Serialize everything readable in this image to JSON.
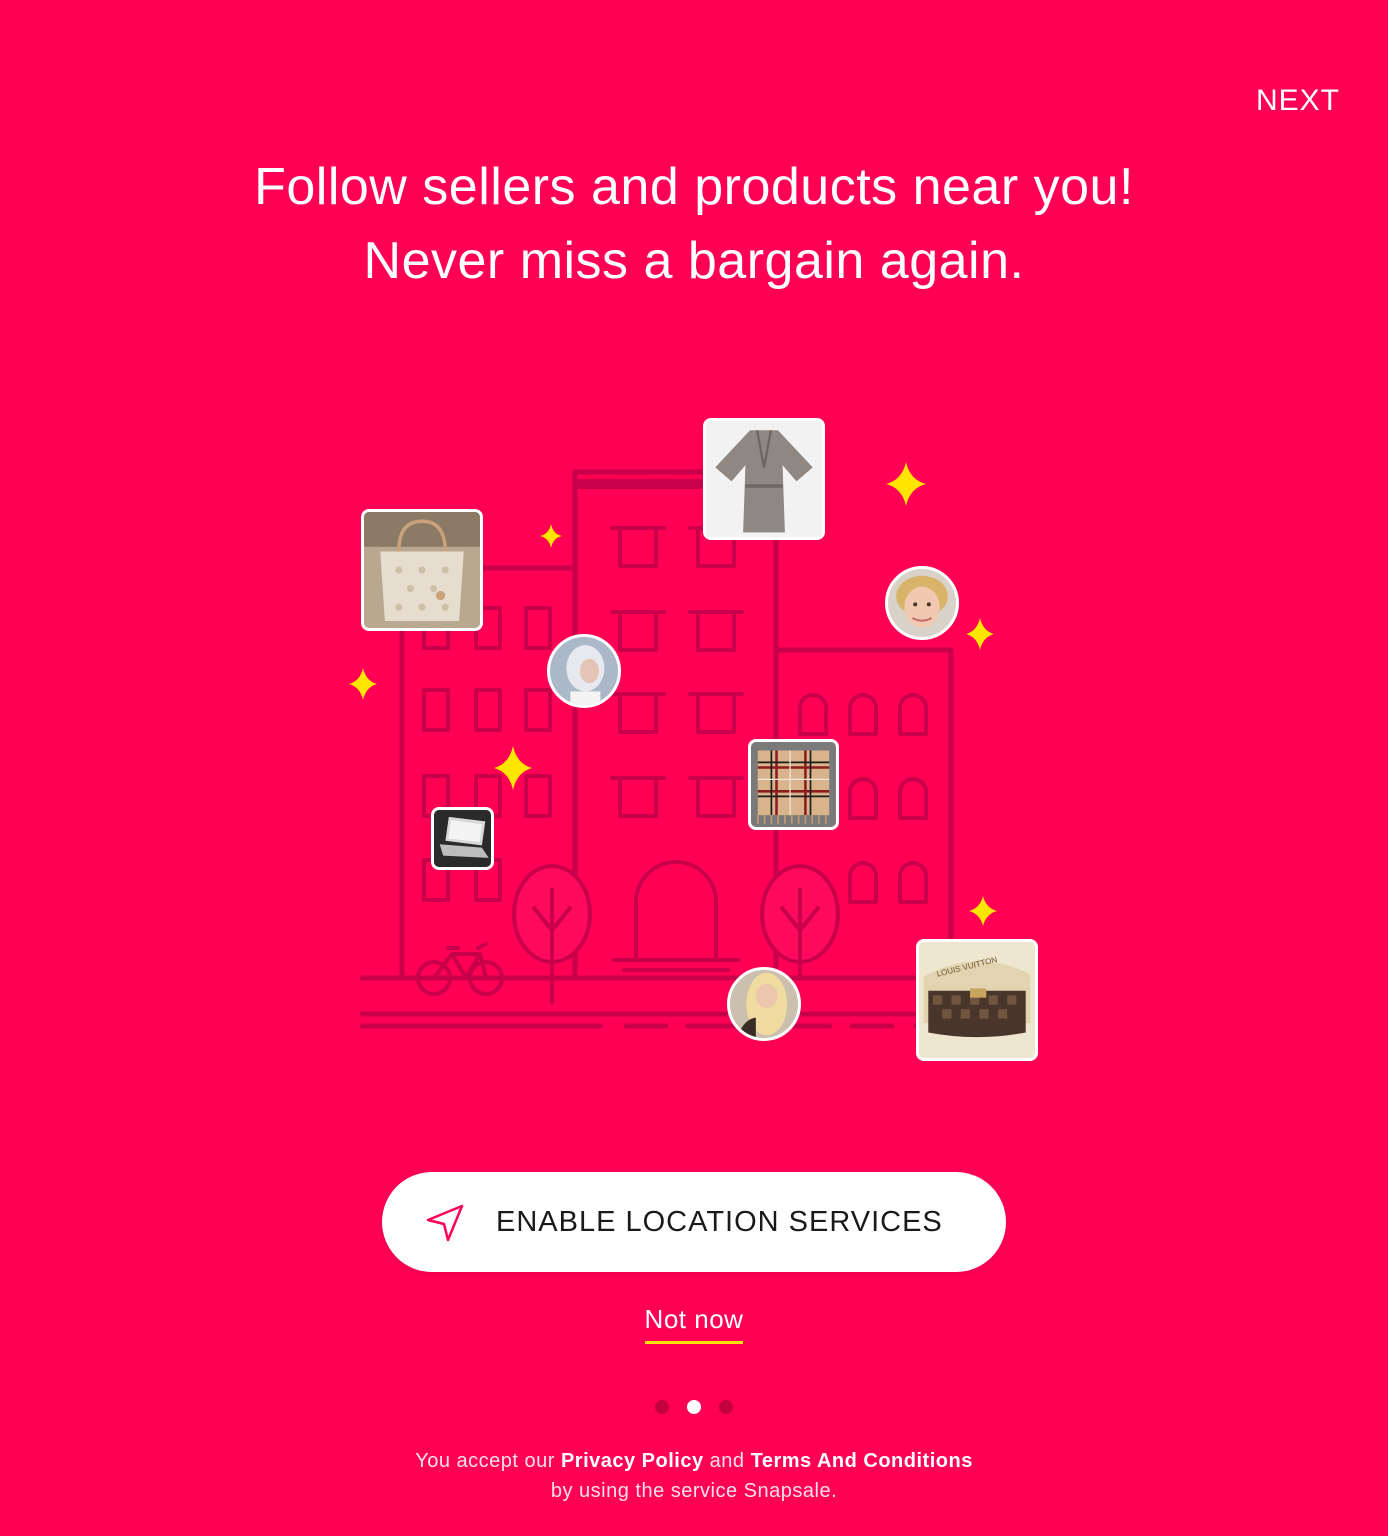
{
  "header": {
    "next_label": "NEXT"
  },
  "headline": {
    "line1": "Follow sellers and products near you!",
    "line2": "Never miss a bargain again."
  },
  "illustration": {
    "products": [
      {
        "name": "product-tote-bag",
        "icon": "tote-bag"
      },
      {
        "name": "product-robe",
        "icon": "robe"
      },
      {
        "name": "product-scarf",
        "icon": "plaid-scarf"
      },
      {
        "name": "product-laptop",
        "icon": "laptop"
      },
      {
        "name": "product-handbag",
        "icon": "monogram-handbag"
      }
    ],
    "avatars": [
      {
        "name": "seller-avatar-1"
      },
      {
        "name": "seller-avatar-2"
      },
      {
        "name": "seller-avatar-3"
      }
    ],
    "handbag_brand_text": "LOUIS VUITTON",
    "colors": {
      "background": "#ff0055",
      "sparkle": "#ffe600",
      "lines": "#c8004a"
    }
  },
  "enable_button": {
    "label": "ENABLE LOCATION SERVICES",
    "icon": "location-arrow-icon"
  },
  "not_now": {
    "label": "Not now"
  },
  "pagination": {
    "total": 3,
    "active": 2
  },
  "footer": {
    "prefix": "You accept our ",
    "privacy": "Privacy Policy",
    "and": " and ",
    "terms": "Terms And Conditions",
    "line2": "by using the service Snapsale."
  }
}
